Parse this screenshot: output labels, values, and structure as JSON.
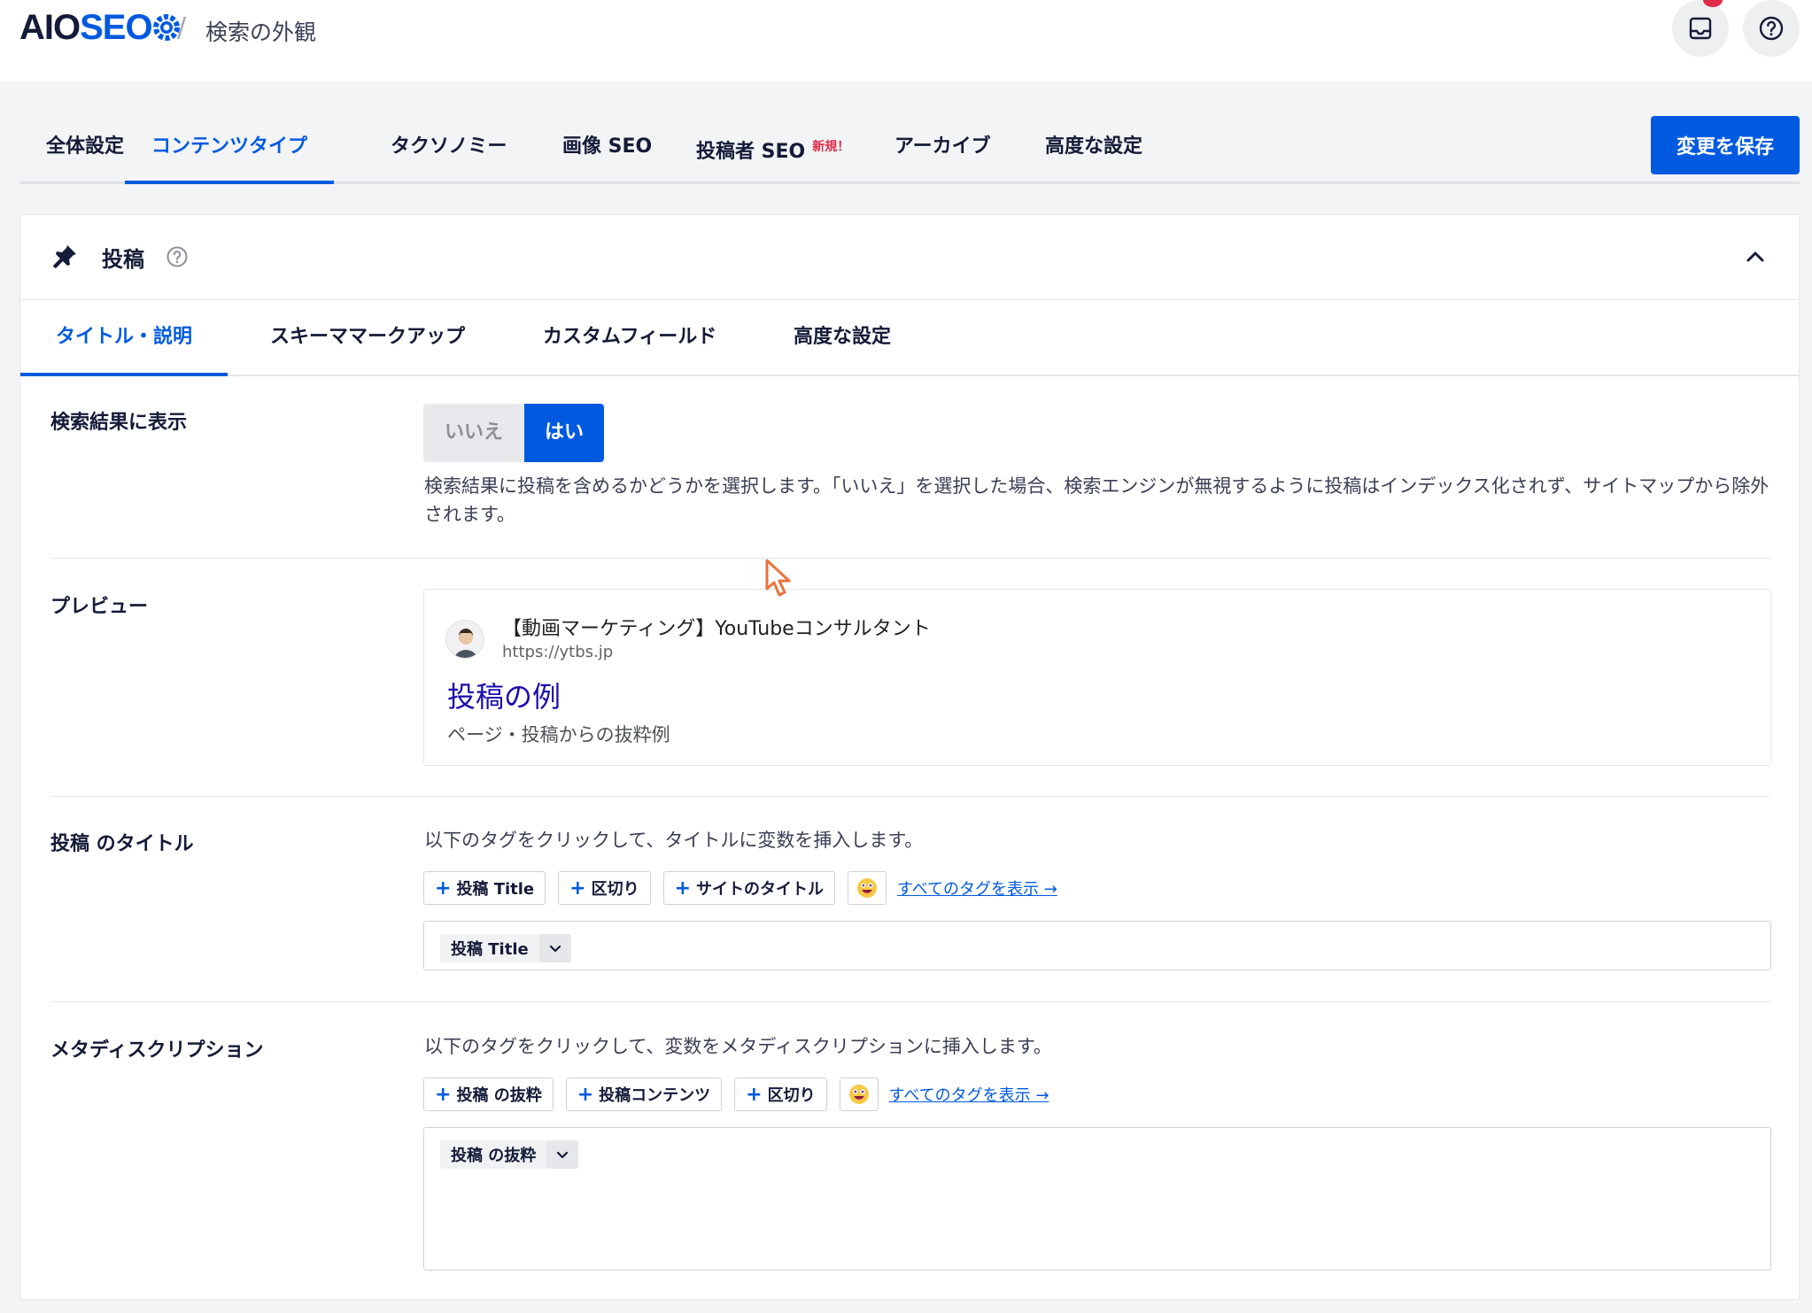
{
  "header": {
    "logo_aio": "AIO",
    "logo_seo": "SEO",
    "breadcrumb_sep": "/",
    "page_title": "検索の外観",
    "inbox_icon": "inbox-icon",
    "help_icon": "question-circle-icon",
    "notification_badge": "!"
  },
  "main_tabs": [
    {
      "label": "全体設定",
      "active": false
    },
    {
      "label": "コンテンツタイプ",
      "active": true
    },
    {
      "label": "タクソノミー",
      "active": false
    },
    {
      "label": "画像 SEO",
      "active": false
    },
    {
      "label": "投稿者 SEO",
      "badge": "新規！",
      "active": false
    },
    {
      "label": "アーカイブ",
      "active": false
    },
    {
      "label": "高度な設定",
      "active": false
    }
  ],
  "save_button": "変更を保存",
  "card": {
    "title": "投稿",
    "pin_icon": "pin-icon",
    "help_icon": "question-circle-icon",
    "collapse_icon": "chevron-up-icon",
    "sub_tabs": [
      {
        "label": "タイトル・説明",
        "active": true
      },
      {
        "label": "スキーママークアップ",
        "active": false
      },
      {
        "label": "カスタムフィールド",
        "active": false
      },
      {
        "label": "高度な設定",
        "active": false
      }
    ],
    "show_in_search": {
      "label": "検索結果に表示",
      "no": "いいえ",
      "yes": "はい",
      "selected": "はい",
      "description": "検索結果に投稿を含めるかどうかを選択します。「いいえ」を選択した場合、検索エンジンが無視するように投稿はインデックス化されず、サイトマップから除外されます。"
    },
    "preview": {
      "label": "プレビュー",
      "site_name": "【動画マーケティング】YouTubeコンサルタント",
      "url": "https://ytbs.jp",
      "title": "投稿の例",
      "description": "ページ・投稿からの抜粋例"
    },
    "post_title": {
      "label": "投稿 のタイトル",
      "hint": "以下のタグをクリックして、タイトルに変数を挿入します。",
      "tags": [
        "投稿 Title",
        "区切り",
        "サイトのタイトル"
      ],
      "all_tags": "すべてのタグを表示 →",
      "token": "投稿 Title"
    },
    "meta_description": {
      "label": "メタディスクリプション",
      "hint": "以下のタグをクリックして、変数をメタディスクリプションに挿入します。",
      "tags": [
        "投稿 の抜粋",
        "投稿コンテンツ",
        "区切り"
      ],
      "all_tags": "すべてのタグを表示 →",
      "token": "投稿 の抜粋"
    }
  },
  "colors": {
    "accent": "#005ae0",
    "text": "#141b38",
    "badge_red": "#df2a4a",
    "preview_link": "#1a0dab"
  }
}
